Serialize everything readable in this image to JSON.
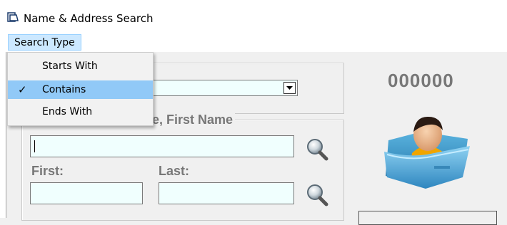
{
  "window": {
    "title": "Name & Address Search"
  },
  "menu": {
    "search_type_label": "Search Type"
  },
  "search_type_menu": {
    "items": [
      {
        "label": "Starts With",
        "checked": false
      },
      {
        "label": "Contains",
        "checked": true
      },
      {
        "label": "Ends With",
        "checked": false
      }
    ]
  },
  "name_group": {
    "legend_partial": "st Name, First Name",
    "full_name_value": "",
    "first_label": "First:",
    "last_label": "Last:",
    "first_value": "",
    "last_value": ""
  },
  "record": {
    "id_number": "000000"
  },
  "colors": {
    "field_bg": "#f0fffe",
    "menu_highlight": "#cce8ff",
    "checked_item_bg": "#91c9f7",
    "label_gray": "#777777"
  }
}
